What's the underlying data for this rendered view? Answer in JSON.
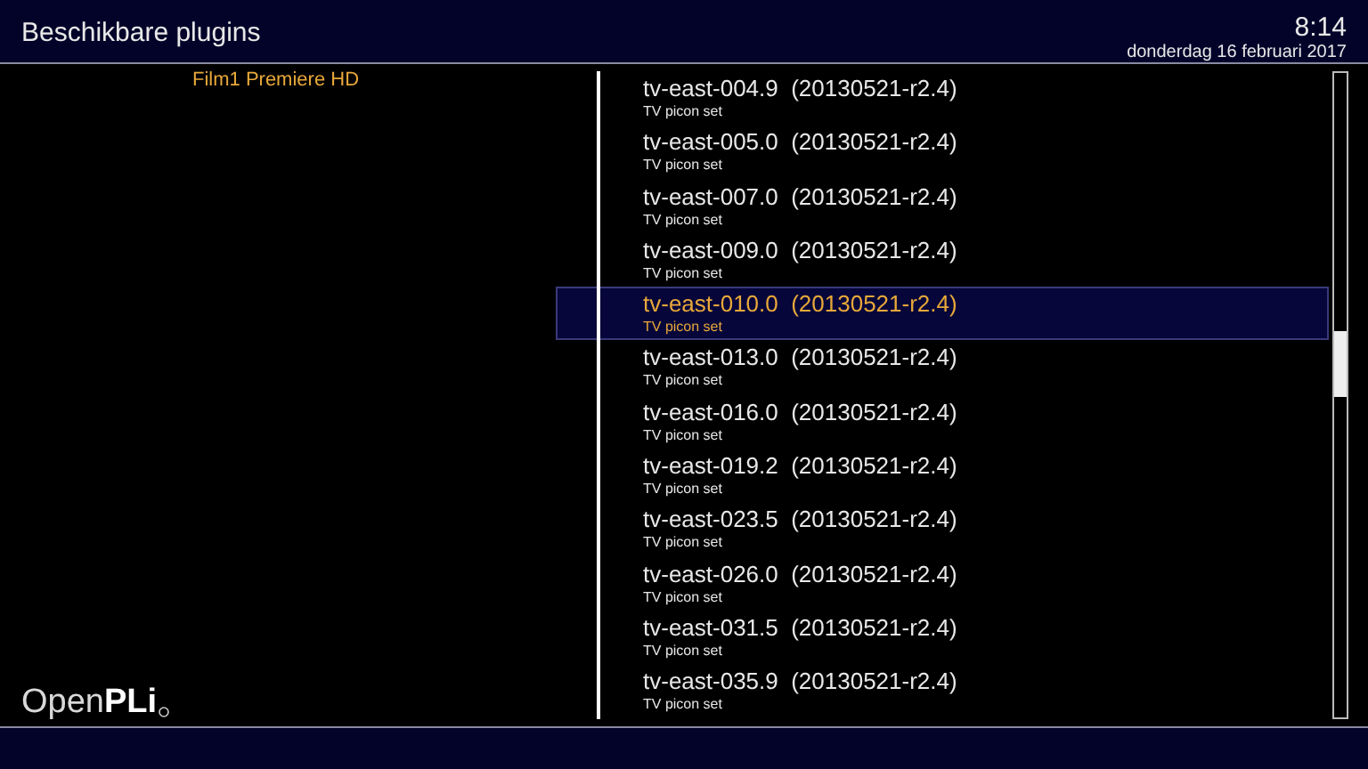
{
  "header": {
    "title": "Beschikbare plugins",
    "time": "8:14",
    "date": "donderdag 16 februari 2017"
  },
  "channel": "Film1 Premiere HD",
  "logo": {
    "light": "Open",
    "bold": "PLi"
  },
  "plugins": [
    {
      "name": "tv-east-004.9  (20130521-r2.4)",
      "description": "TV picon set",
      "selected": false
    },
    {
      "name": "tv-east-005.0  (20130521-r2.4)",
      "description": "TV picon set",
      "selected": false
    },
    {
      "name": "tv-east-007.0  (20130521-r2.4)",
      "description": "TV picon set",
      "selected": false
    },
    {
      "name": "tv-east-009.0  (20130521-r2.4)",
      "description": "TV picon set",
      "selected": false
    },
    {
      "name": "tv-east-010.0  (20130521-r2.4)",
      "description": "TV picon set",
      "selected": true
    },
    {
      "name": "tv-east-013.0  (20130521-r2.4)",
      "description": "TV picon set",
      "selected": false
    },
    {
      "name": "tv-east-016.0  (20130521-r2.4)",
      "description": "TV picon set",
      "selected": false
    },
    {
      "name": "tv-east-019.2  (20130521-r2.4)",
      "description": "TV picon set",
      "selected": false
    },
    {
      "name": "tv-east-023.5  (20130521-r2.4)",
      "description": "TV picon set",
      "selected": false
    },
    {
      "name": "tv-east-026.0  (20130521-r2.4)",
      "description": "TV picon set",
      "selected": false
    },
    {
      "name": "tv-east-031.5  (20130521-r2.4)",
      "description": "TV picon set",
      "selected": false
    },
    {
      "name": "tv-east-035.9  (20130521-r2.4)",
      "description": "TV picon set",
      "selected": false
    }
  ]
}
